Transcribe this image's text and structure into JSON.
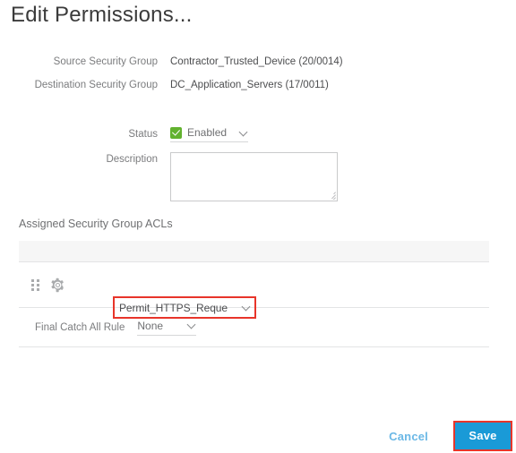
{
  "dialog": {
    "title": "Edit Permissions..."
  },
  "fields": {
    "source_security_group": {
      "label": "Source Security Group",
      "value": "Contractor_Trusted_Device (20/0014)"
    },
    "destination_security_group": {
      "label": "Destination Security Group",
      "value": "DC_Application_Servers (17/0011)"
    },
    "status": {
      "label": "Status",
      "value": "Enabled",
      "checked": true
    },
    "description": {
      "label": "Description",
      "value": "",
      "placeholder": ""
    }
  },
  "acl_section": {
    "heading": "Assigned Security Group ACLs",
    "rows": [
      {
        "drag_handle": "drag-handle-icon",
        "gear": "gear-icon",
        "acl_value": "Permit_HTTPS_Reque"
      }
    ],
    "final_catch_all": {
      "label": "Final Catch All Rule",
      "value": "None"
    }
  },
  "footer": {
    "cancel_label": "Cancel",
    "save_label": "Save"
  },
  "colors": {
    "accent_blue": "#1a9ad7",
    "cancel_blue": "#6bb8e6",
    "highlight_red": "#e8352a",
    "checkbox_green": "#62b22f",
    "header_gray": "#f6f6f6",
    "border_gray": "#e3e4e5"
  }
}
